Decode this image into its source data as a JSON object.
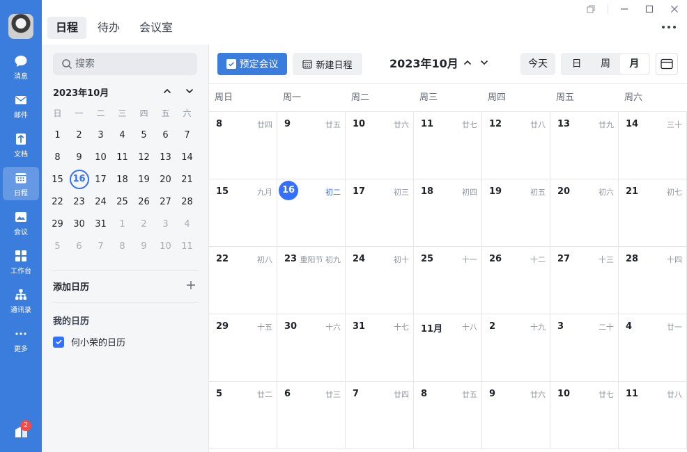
{
  "rail": {
    "items": [
      {
        "label": "消息",
        "icon": "message-icon"
      },
      {
        "label": "邮件",
        "icon": "mail-icon"
      },
      {
        "label": "文档",
        "icon": "document-icon"
      },
      {
        "label": "日程",
        "icon": "calendar-icon",
        "active": true
      },
      {
        "label": "会议",
        "icon": "meeting-icon"
      },
      {
        "label": "工作台",
        "icon": "workbench-icon"
      },
      {
        "label": "通讯录",
        "icon": "contacts-icon"
      },
      {
        "label": "更多",
        "icon": "more-dots-icon"
      }
    ],
    "bottom_badge": "2"
  },
  "top_tabs": [
    {
      "label": "日程",
      "active": true
    },
    {
      "label": "待办"
    },
    {
      "label": "会议室"
    }
  ],
  "side": {
    "search_placeholder": "搜索",
    "mini_title": "2023年10月",
    "weekdays": [
      "日",
      "一",
      "二",
      "三",
      "四",
      "五",
      "六"
    ],
    "days": [
      {
        "d": "1"
      },
      {
        "d": "2"
      },
      {
        "d": "3"
      },
      {
        "d": "4"
      },
      {
        "d": "5"
      },
      {
        "d": "6"
      },
      {
        "d": "7"
      },
      {
        "d": "8"
      },
      {
        "d": "9"
      },
      {
        "d": "10"
      },
      {
        "d": "11"
      },
      {
        "d": "12"
      },
      {
        "d": "13"
      },
      {
        "d": "14"
      },
      {
        "d": "15"
      },
      {
        "d": "16",
        "today": true
      },
      {
        "d": "17"
      },
      {
        "d": "18"
      },
      {
        "d": "19"
      },
      {
        "d": "20"
      },
      {
        "d": "21"
      },
      {
        "d": "22"
      },
      {
        "d": "23"
      },
      {
        "d": "24"
      },
      {
        "d": "25"
      },
      {
        "d": "26"
      },
      {
        "d": "27"
      },
      {
        "d": "28"
      },
      {
        "d": "29"
      },
      {
        "d": "30"
      },
      {
        "d": "31"
      },
      {
        "d": "1",
        "other": true
      },
      {
        "d": "2",
        "other": true
      },
      {
        "d": "3",
        "other": true
      },
      {
        "d": "4",
        "other": true
      },
      {
        "d": "5",
        "other": true
      },
      {
        "d": "6",
        "other": true
      },
      {
        "d": "7",
        "other": true
      },
      {
        "d": "8",
        "other": true
      },
      {
        "d": "9",
        "other": true
      },
      {
        "d": "10",
        "other": true
      },
      {
        "d": "11",
        "other": true
      }
    ],
    "add_calendar_label": "添加日历",
    "my_calendars_label": "我的日历",
    "my_calendar_item": "何小荣的日历"
  },
  "toolbar": {
    "book_meeting": "预定会议",
    "new_event": "新建日程",
    "month_title": "2023年10月",
    "today": "今天",
    "views": [
      {
        "label": "日"
      },
      {
        "label": "周"
      },
      {
        "label": "月",
        "active": true
      }
    ]
  },
  "calendar": {
    "weekdays": [
      "周日",
      "周一",
      "周二",
      "周三",
      "周四",
      "周五",
      "周六"
    ],
    "weeks": [
      [
        {
          "day": "8",
          "lunar": "廿四"
        },
        {
          "day": "9",
          "lunar": "廿五"
        },
        {
          "day": "10",
          "lunar": "廿六"
        },
        {
          "day": "11",
          "lunar": "廿七"
        },
        {
          "day": "12",
          "lunar": "廿八"
        },
        {
          "day": "13",
          "lunar": "廿九"
        },
        {
          "day": "14",
          "lunar": "三十"
        }
      ],
      [
        {
          "day": "15",
          "lunar": "九月"
        },
        {
          "day": "16",
          "lunar": "初二",
          "today": true
        },
        {
          "day": "17",
          "lunar": "初三"
        },
        {
          "day": "18",
          "lunar": "初四"
        },
        {
          "day": "19",
          "lunar": "初五"
        },
        {
          "day": "20",
          "lunar": "初六"
        },
        {
          "day": "21",
          "lunar": "初七"
        }
      ],
      [
        {
          "day": "22",
          "lunar": "初八"
        },
        {
          "day": "23",
          "lunar": "重阳节 初九"
        },
        {
          "day": "24",
          "lunar": "初十"
        },
        {
          "day": "25",
          "lunar": "十一"
        },
        {
          "day": "26",
          "lunar": "十二"
        },
        {
          "day": "27",
          "lunar": "十三"
        },
        {
          "day": "28",
          "lunar": "十四"
        }
      ],
      [
        {
          "day": "29",
          "lunar": "十五"
        },
        {
          "day": "30",
          "lunar": "十六"
        },
        {
          "day": "31",
          "lunar": "十七"
        },
        {
          "day": "11月",
          "lunar": "十八"
        },
        {
          "day": "2",
          "lunar": "十九"
        },
        {
          "day": "3",
          "lunar": "二十"
        },
        {
          "day": "4",
          "lunar": "廿一"
        }
      ],
      [
        {
          "day": "5",
          "lunar": "廿二"
        },
        {
          "day": "6",
          "lunar": "廿三"
        },
        {
          "day": "7",
          "lunar": "廿四"
        },
        {
          "day": "8",
          "lunar": "廿五"
        },
        {
          "day": "9",
          "lunar": "廿六"
        },
        {
          "day": "10",
          "lunar": "廿七"
        },
        {
          "day": "11",
          "lunar": "廿八"
        }
      ]
    ]
  },
  "colors": {
    "brand": "#3b7ddd",
    "accent": "#3370ff",
    "badge": "#f54a45"
  }
}
